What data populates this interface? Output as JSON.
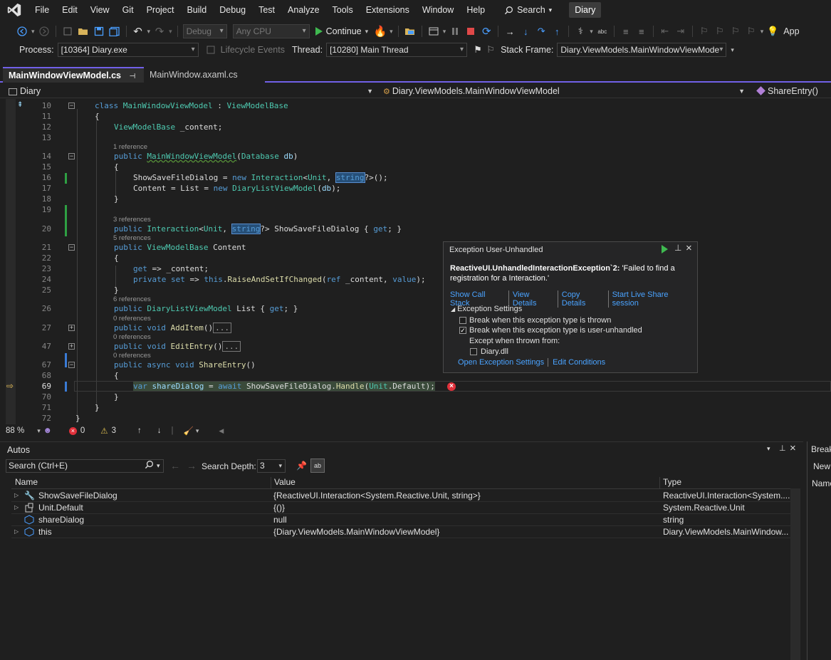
{
  "menu": {
    "items": [
      "File",
      "Edit",
      "View",
      "Git",
      "Project",
      "Build",
      "Debug",
      "Test",
      "Analyze",
      "Tools",
      "Extensions",
      "Window",
      "Help"
    ],
    "search_label": "Search",
    "solution_badge": "Diary"
  },
  "toolbar": {
    "config": "Debug",
    "platform": "Any CPU",
    "continue_label": "Continue",
    "process_label": "Process:",
    "process_value": "[10364] Diary.exe",
    "lifecycle_label": "Lifecycle Events",
    "thread_label": "Thread:",
    "thread_value": "[10280] Main Thread",
    "stackframe_label": "Stack Frame:",
    "stackframe_value": "Diary.ViewModels.MainWindowViewMode",
    "app_label": "App"
  },
  "tabs": [
    {
      "label": "MainWindowViewModel.cs",
      "pin": "⊣",
      "close": "×"
    },
    {
      "label": "MainWindow.axaml.cs"
    }
  ],
  "navbar": {
    "project": "Diary",
    "class": "Diary.ViewModels.MainWindowViewModel",
    "member": "ShareEntry()"
  },
  "editor": {
    "lines": [
      "10",
      "11",
      "12",
      "13",
      "14",
      "15",
      "16",
      "17",
      "18",
      "19",
      "20",
      "21",
      "22",
      "23",
      "24",
      "25",
      "26",
      "27",
      "47",
      "67",
      "68",
      "69",
      "70",
      "71",
      "72"
    ],
    "refs": {
      "r14": "1 reference",
      "r20": "3 references",
      "r21": "5 references",
      "r26": "6 references",
      "r27": "0 references",
      "r47": "0 references",
      "r67": "0 references"
    },
    "zoom": "88 %",
    "errors": "0",
    "warnings": "3"
  },
  "exception": {
    "title": "Exception User-Unhandled",
    "exception_type": "ReactiveUI.UnhandledInteractionException`2:",
    "message": " 'Failed to find a registration for a Interaction.'",
    "links": [
      "Show Call Stack",
      "View Details",
      "Copy Details",
      "Start Live Share session"
    ],
    "settings_header": "Exception Settings",
    "opt_thrown": "Break when this exception type is thrown",
    "opt_unhandled": "Break when this exception type is user-unhandled",
    "except_label": "Except when thrown from:",
    "opt_dll": "Diary.dll",
    "bottom_links": [
      "Open Exception Settings",
      "Edit Conditions"
    ]
  },
  "autos": {
    "title": "Autos",
    "search_placeholder": "Search (Ctrl+E)",
    "depth_label": "Search Depth:",
    "depth_value": "3",
    "columns": [
      "Name",
      "Value",
      "Type"
    ],
    "rows": [
      {
        "name": "ShowSaveFileDialog",
        "value": "{ReactiveUI.Interaction<System.Reactive.Unit, string>}",
        "type": "ReactiveUI.Interaction<System...."
      },
      {
        "name": "Unit.Default",
        "value": "{()}",
        "type": "System.Reactive.Unit"
      },
      {
        "name": "shareDialog",
        "value": "null",
        "type": "string"
      },
      {
        "name": "this",
        "value": "{Diary.ViewModels.MainWindowViewModel}",
        "type": "Diary.ViewModels.MainWindow..."
      }
    ]
  },
  "side_panel": {
    "title": "Break",
    "new_label": "New",
    "name_col": "Name"
  }
}
